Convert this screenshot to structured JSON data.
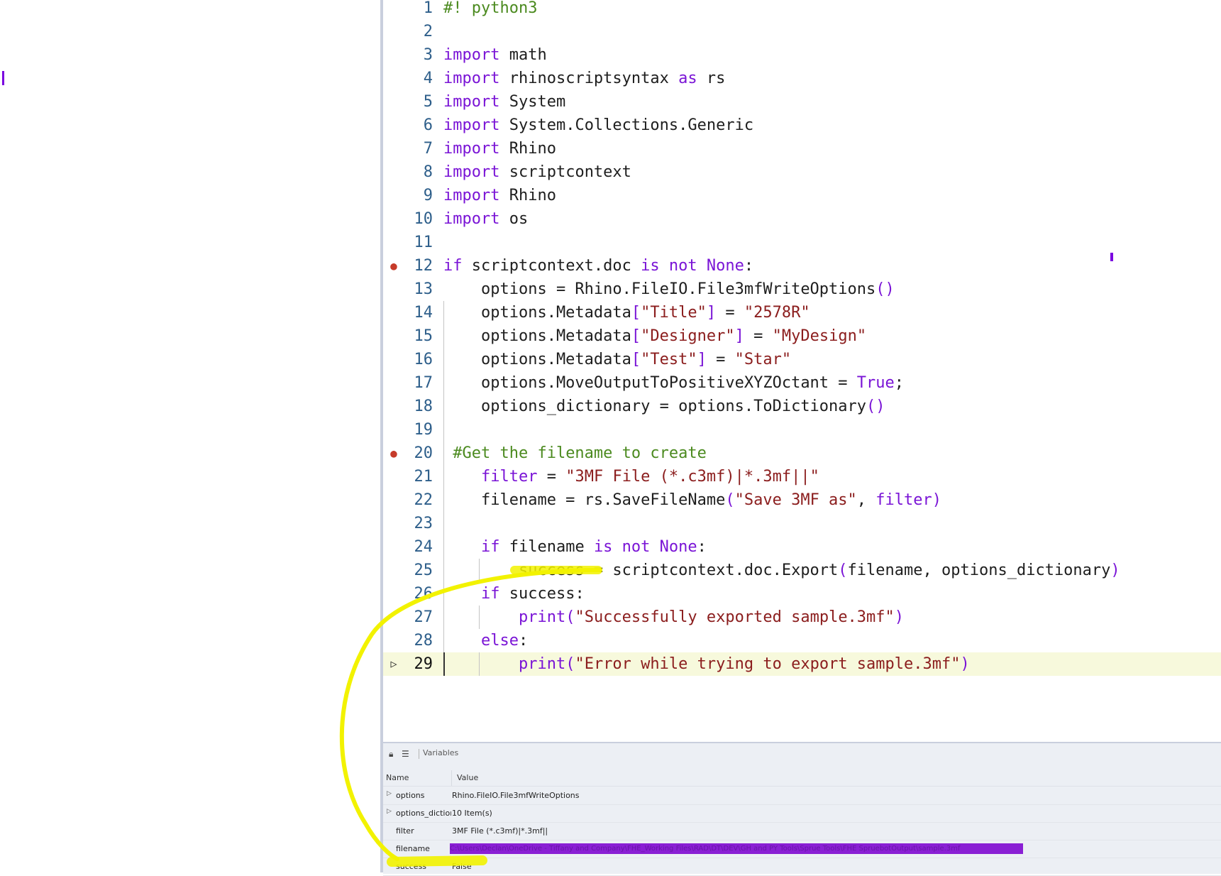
{
  "editor": {
    "lines": [
      {
        "n": "1",
        "segs": [
          [
            "cm",
            "#! python3"
          ]
        ]
      },
      {
        "n": "2",
        "segs": []
      },
      {
        "n": "3",
        "segs": [
          [
            "kw",
            "import"
          ],
          [
            "",
            " math"
          ]
        ]
      },
      {
        "n": "4",
        "segs": [
          [
            "kw",
            "import"
          ],
          [
            "",
            " rhinoscriptsyntax "
          ],
          [
            "kw",
            "as"
          ],
          [
            "",
            " rs"
          ]
        ]
      },
      {
        "n": "5",
        "segs": [
          [
            "kw",
            "import"
          ],
          [
            "",
            " System"
          ]
        ]
      },
      {
        "n": "6",
        "segs": [
          [
            "kw",
            "import"
          ],
          [
            "",
            " System.Collections.Generic"
          ]
        ]
      },
      {
        "n": "7",
        "segs": [
          [
            "kw",
            "import"
          ],
          [
            "",
            " Rhino"
          ]
        ]
      },
      {
        "n": "8",
        "segs": [
          [
            "kw",
            "import"
          ],
          [
            "",
            " scriptcontext"
          ]
        ]
      },
      {
        "n": "9",
        "segs": [
          [
            "kw",
            "import"
          ],
          [
            "",
            " Rhino"
          ]
        ]
      },
      {
        "n": "10",
        "segs": [
          [
            "kw",
            "import"
          ],
          [
            "",
            " os"
          ]
        ]
      },
      {
        "n": "11",
        "segs": []
      },
      {
        "n": "12",
        "bp": true,
        "segs": [
          [
            "kw",
            "if"
          ],
          [
            "",
            " scriptcontext.doc "
          ],
          [
            "kw",
            "is not None"
          ],
          [
            "",
            ":"
          ]
        ]
      },
      {
        "n": "13",
        "segs": [
          [
            "",
            "    options = Rhino.FileIO.File3mfWriteOptions"
          ],
          [
            "br",
            "()"
          ]
        ]
      },
      {
        "n": "14",
        "segs": [
          [
            "",
            "    options.Metadata"
          ],
          [
            "br",
            "["
          ],
          [
            "st",
            "\"Title\""
          ],
          [
            "br",
            "]"
          ],
          [
            "",
            " = "
          ],
          [
            "st",
            "\"2578R\""
          ]
        ]
      },
      {
        "n": "15",
        "segs": [
          [
            "",
            "    options.Metadata"
          ],
          [
            "br",
            "["
          ],
          [
            "st",
            "\"Designer\""
          ],
          [
            "br",
            "]"
          ],
          [
            "",
            " = "
          ],
          [
            "st",
            "\"MyDesign\""
          ]
        ]
      },
      {
        "n": "16",
        "segs": [
          [
            "",
            "    options.Metadata"
          ],
          [
            "br",
            "["
          ],
          [
            "st",
            "\"Test\""
          ],
          [
            "br",
            "]"
          ],
          [
            "",
            " = "
          ],
          [
            "st",
            "\"Star\""
          ]
        ]
      },
      {
        "n": "17",
        "segs": [
          [
            "",
            "    options.MoveOutputToPositiveXYZOctant = "
          ],
          [
            "kw",
            "True"
          ],
          [
            "",
            ";"
          ]
        ]
      },
      {
        "n": "18",
        "segs": [
          [
            "",
            "    options_dictionary = options.ToDictionary"
          ],
          [
            "br",
            "()"
          ]
        ]
      },
      {
        "n": "19",
        "segs": []
      },
      {
        "n": "20",
        "bp": true,
        "segs": [
          [
            "",
            " "
          ],
          [
            "cm",
            "#Get the filename to create"
          ]
        ]
      },
      {
        "n": "21",
        "segs": [
          [
            "",
            "    "
          ],
          [
            "kw",
            "filter"
          ],
          [
            "",
            " = "
          ],
          [
            "st",
            "\"3MF File (*.c3mf)|*.3mf||\""
          ]
        ]
      },
      {
        "n": "22",
        "segs": [
          [
            "",
            "    filename = rs.SaveFileName"
          ],
          [
            "br",
            "("
          ],
          [
            "st",
            "\"Save 3MF as\""
          ],
          [
            "",
            ", "
          ],
          [
            "kw",
            "filter"
          ],
          [
            "br",
            ")"
          ]
        ]
      },
      {
        "n": "23",
        "segs": []
      },
      {
        "n": "24",
        "segs": [
          [
            "",
            "    "
          ],
          [
            "kw",
            "if"
          ],
          [
            "",
            " filename "
          ],
          [
            "kw",
            "is not None"
          ],
          [
            "",
            ":"
          ]
        ]
      },
      {
        "n": "25",
        "segs": [
          [
            "",
            "        success = scriptcontext.doc.Export"
          ],
          [
            "br",
            "("
          ],
          [
            "",
            "filename, options_dictionary"
          ],
          [
            "br",
            ")"
          ]
        ]
      },
      {
        "n": "26",
        "segs": [
          [
            "",
            "    "
          ],
          [
            "kw",
            "if"
          ],
          [
            "",
            " success:"
          ]
        ]
      },
      {
        "n": "27",
        "segs": [
          [
            "",
            "        "
          ],
          [
            "kw",
            "print"
          ],
          [
            "br",
            "("
          ],
          [
            "st",
            "\"Successfully exported sample.3mf\""
          ],
          [
            "br",
            ")"
          ]
        ]
      },
      {
        "n": "28",
        "segs": [
          [
            "",
            "    "
          ],
          [
            "kw",
            "else"
          ],
          [
            "",
            ":"
          ]
        ]
      },
      {
        "n": "29",
        "current": true,
        "segs": [
          [
            "",
            "        "
          ],
          [
            "kw",
            "print"
          ],
          [
            "br",
            "("
          ],
          [
            "st",
            "\"Error while trying to export sample.3mf\""
          ],
          [
            "br",
            ")"
          ]
        ]
      }
    ]
  },
  "variables": {
    "title": "Variables",
    "col_name": "Name",
    "col_value": "Value",
    "rows": [
      {
        "name": "options",
        "value": "Rhino.FileIO.File3mfWriteOptions",
        "expandable": true
      },
      {
        "name": "options_dictionary",
        "value": "10 Item(s)",
        "expandable": true
      },
      {
        "name": "filter",
        "value": "3MF File (*.c3mf)|*.3mf||",
        "expandable": false
      },
      {
        "name": "filename",
        "value": "C:\\Users\\Declan\\OneDrive - Tiffany and Company\\FHE_Working Files\\RAD\\DT\\DEV\\GH and PY Tools\\Sprue Tools\\FHE SpruebotOutput\\sample.3mf",
        "expandable": false,
        "redacted": true
      },
      {
        "name": "success",
        "value": "False",
        "expandable": false
      }
    ]
  },
  "colors": {
    "keyword": "#7a14d6",
    "string": "#8b1d1d",
    "comment": "#4b8a1f",
    "current_line": "#f7f9dc",
    "annotation": "#f2f200",
    "redaction": "#8a1fd4"
  }
}
